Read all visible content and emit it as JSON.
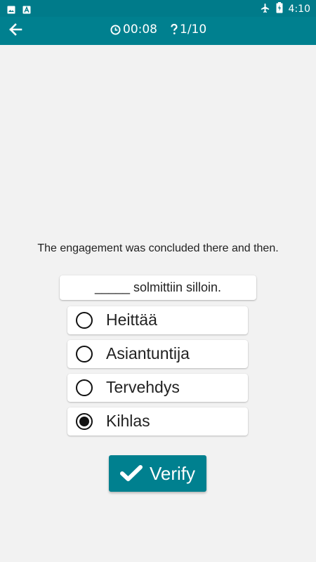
{
  "status_bar": {
    "time": "4:10",
    "icons": [
      "image-icon",
      "font-icon",
      "airplane-icon",
      "battery-icon"
    ]
  },
  "app_bar": {
    "timer": "00:08",
    "question_count": "1/10",
    "icons": [
      "back-arrow-icon",
      "clock-icon",
      "question-icon"
    ]
  },
  "exercise": {
    "prompt": "The engagement was concluded there and then.",
    "sentence": "_____ solmittiin silloin.",
    "options": [
      {
        "label": "Heittää",
        "selected": false
      },
      {
        "label": "Asiantuntija",
        "selected": false
      },
      {
        "label": "Tervehdys",
        "selected": false
      },
      {
        "label": "Kihlas",
        "selected": true
      }
    ]
  },
  "actions": {
    "verify_label": "Verify",
    "verify_icon": "check-icon"
  },
  "colors": {
    "accent": "#00808f",
    "status_bar": "#007b8a",
    "background": "#f2f2f2"
  }
}
